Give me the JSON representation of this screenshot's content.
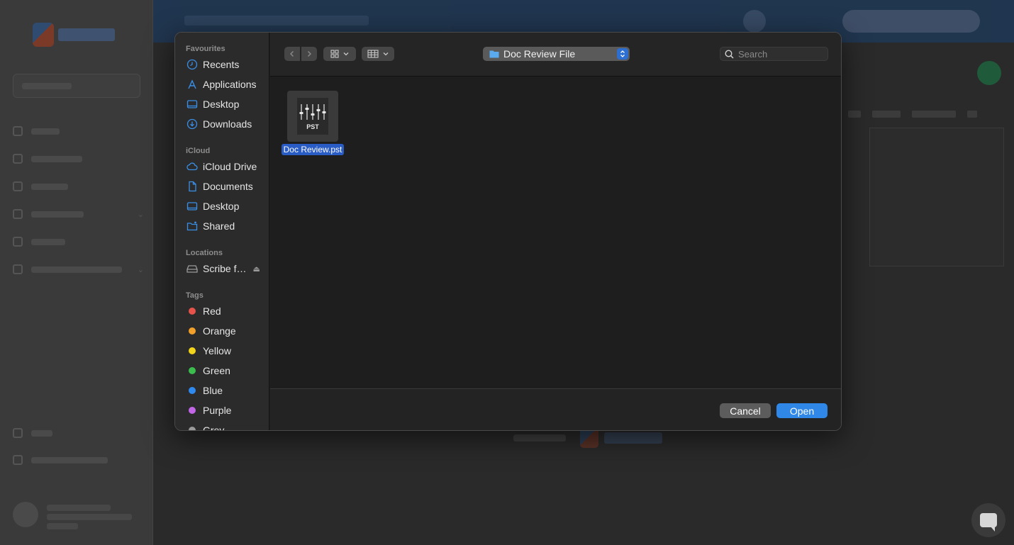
{
  "dialog": {
    "sidebar": {
      "favourites_title": "Favourites",
      "favourites": [
        {
          "label": "Recents",
          "icon": "clock-icon"
        },
        {
          "label": "Applications",
          "icon": "applications-icon"
        },
        {
          "label": "Desktop",
          "icon": "desktop-icon"
        },
        {
          "label": "Downloads",
          "icon": "download-icon"
        }
      ],
      "icloud_title": "iCloud",
      "icloud": [
        {
          "label": "iCloud Drive",
          "icon": "cloud-icon"
        },
        {
          "label": "Documents",
          "icon": "document-icon"
        },
        {
          "label": "Desktop",
          "icon": "desktop-icon"
        },
        {
          "label": "Shared",
          "icon": "shared-folder-icon"
        }
      ],
      "locations_title": "Locations",
      "locations": [
        {
          "label": "Scribe f…",
          "icon": "drive-icon"
        }
      ],
      "tags_title": "Tags",
      "tags": [
        {
          "label": "Red",
          "color": "#e5534b"
        },
        {
          "label": "Orange",
          "color": "#f0a02a"
        },
        {
          "label": "Yellow",
          "color": "#f2d31b"
        },
        {
          "label": "Green",
          "color": "#3bbd4e"
        },
        {
          "label": "Blue",
          "color": "#2f8af0"
        },
        {
          "label": "Purple",
          "color": "#c266e8"
        },
        {
          "label": "Grey",
          "color": "#9a9a9a"
        }
      ]
    },
    "toolbar": {
      "location": "Doc Review File",
      "search_placeholder": "Search"
    },
    "files": [
      {
        "name": "Doc Review.pst",
        "ext": "PST",
        "selected": true
      }
    ],
    "buttons": {
      "cancel": "Cancel",
      "open": "Open"
    },
    "colors": {
      "accent": "#2f87e8",
      "selection": "#2a5cc5",
      "sidebar_icon": "#3a8ee6"
    }
  }
}
